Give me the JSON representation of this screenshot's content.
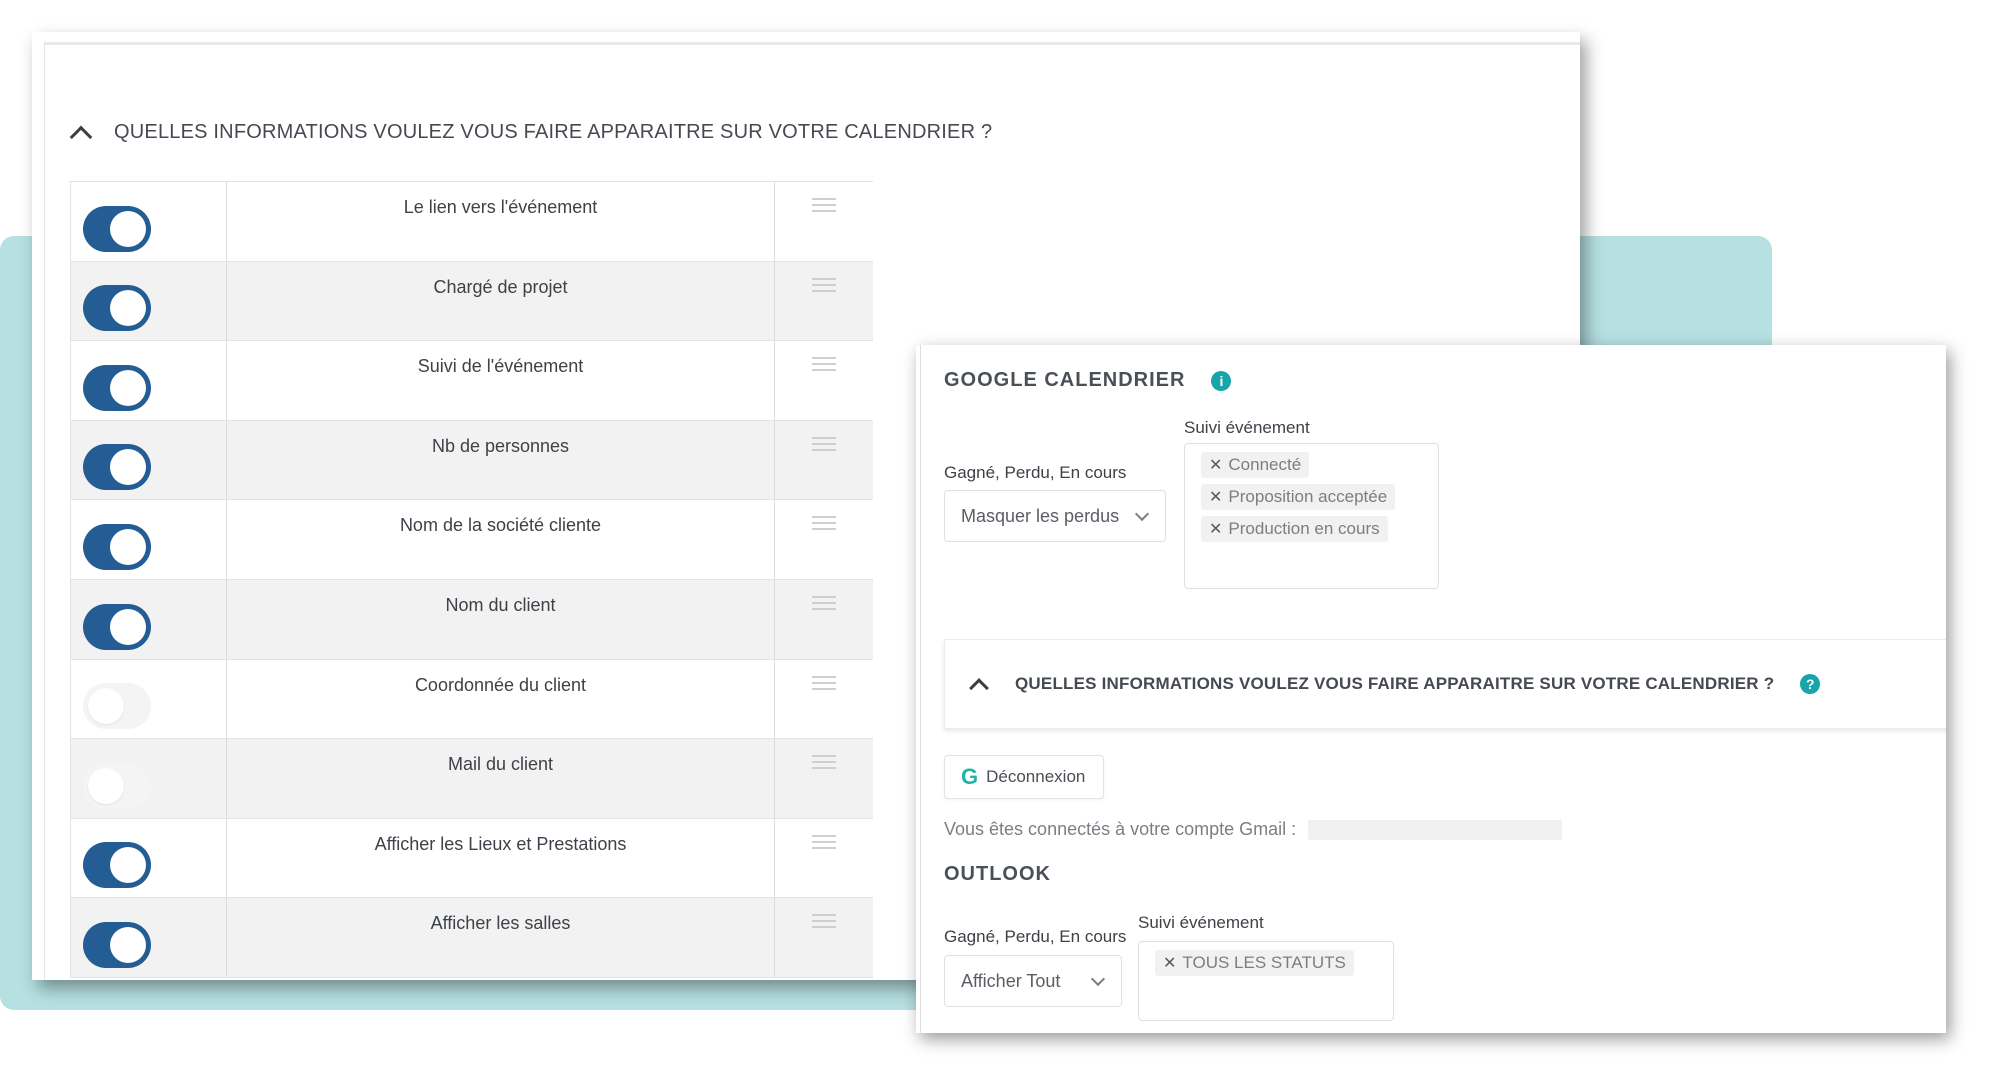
{
  "calendar_fields_panel": {
    "title": "QUELLES INFORMATIONS VOULEZ VOUS FAIRE APPARAITRE SUR VOTRE CALENDRIER ?",
    "rows": [
      {
        "label": "Le lien vers l'événement",
        "enabled": true
      },
      {
        "label": "Chargé de projet",
        "enabled": true
      },
      {
        "label": "Suivi de l'événement",
        "enabled": true
      },
      {
        "label": "Nb de personnes",
        "enabled": true
      },
      {
        "label": "Nom de la société cliente",
        "enabled": true
      },
      {
        "label": "Nom du client",
        "enabled": true
      },
      {
        "label": "Coordonnée du client",
        "enabled": false
      },
      {
        "label": "Mail du client",
        "enabled": false
      },
      {
        "label": "Afficher les Lieux et Prestations",
        "enabled": true
      },
      {
        "label": "Afficher les salles",
        "enabled": true
      }
    ]
  },
  "google": {
    "title": "GOOGLE CALENDRIER",
    "status_label": "Gagné, Perdu, En cours",
    "status_value": "Masquer les perdus",
    "tracking_label": "Suivi événement",
    "tracking_tags": [
      "Connecté",
      "Proposition acceptée",
      "Production en cours"
    ],
    "collapse_title": "QUELLES INFORMATIONS VOULEZ VOUS FAIRE APPARAITRE SUR VOTRE CALENDRIER ?",
    "disconnect_label": "Déconnexion",
    "connected_text": "Vous êtes connectés à votre compte Gmail :"
  },
  "outlook": {
    "title": "OUTLOOK",
    "status_label": "Gagné, Perdu, En cours",
    "status_value": "Afficher Tout",
    "tracking_label": "Suivi événement",
    "tracking_tags": [
      "TOUS LES STATUTS"
    ]
  },
  "colors": {
    "toggle_on": "#235d93",
    "accent_teal": "#17a5a9",
    "background_band": "#b6e0e1"
  }
}
